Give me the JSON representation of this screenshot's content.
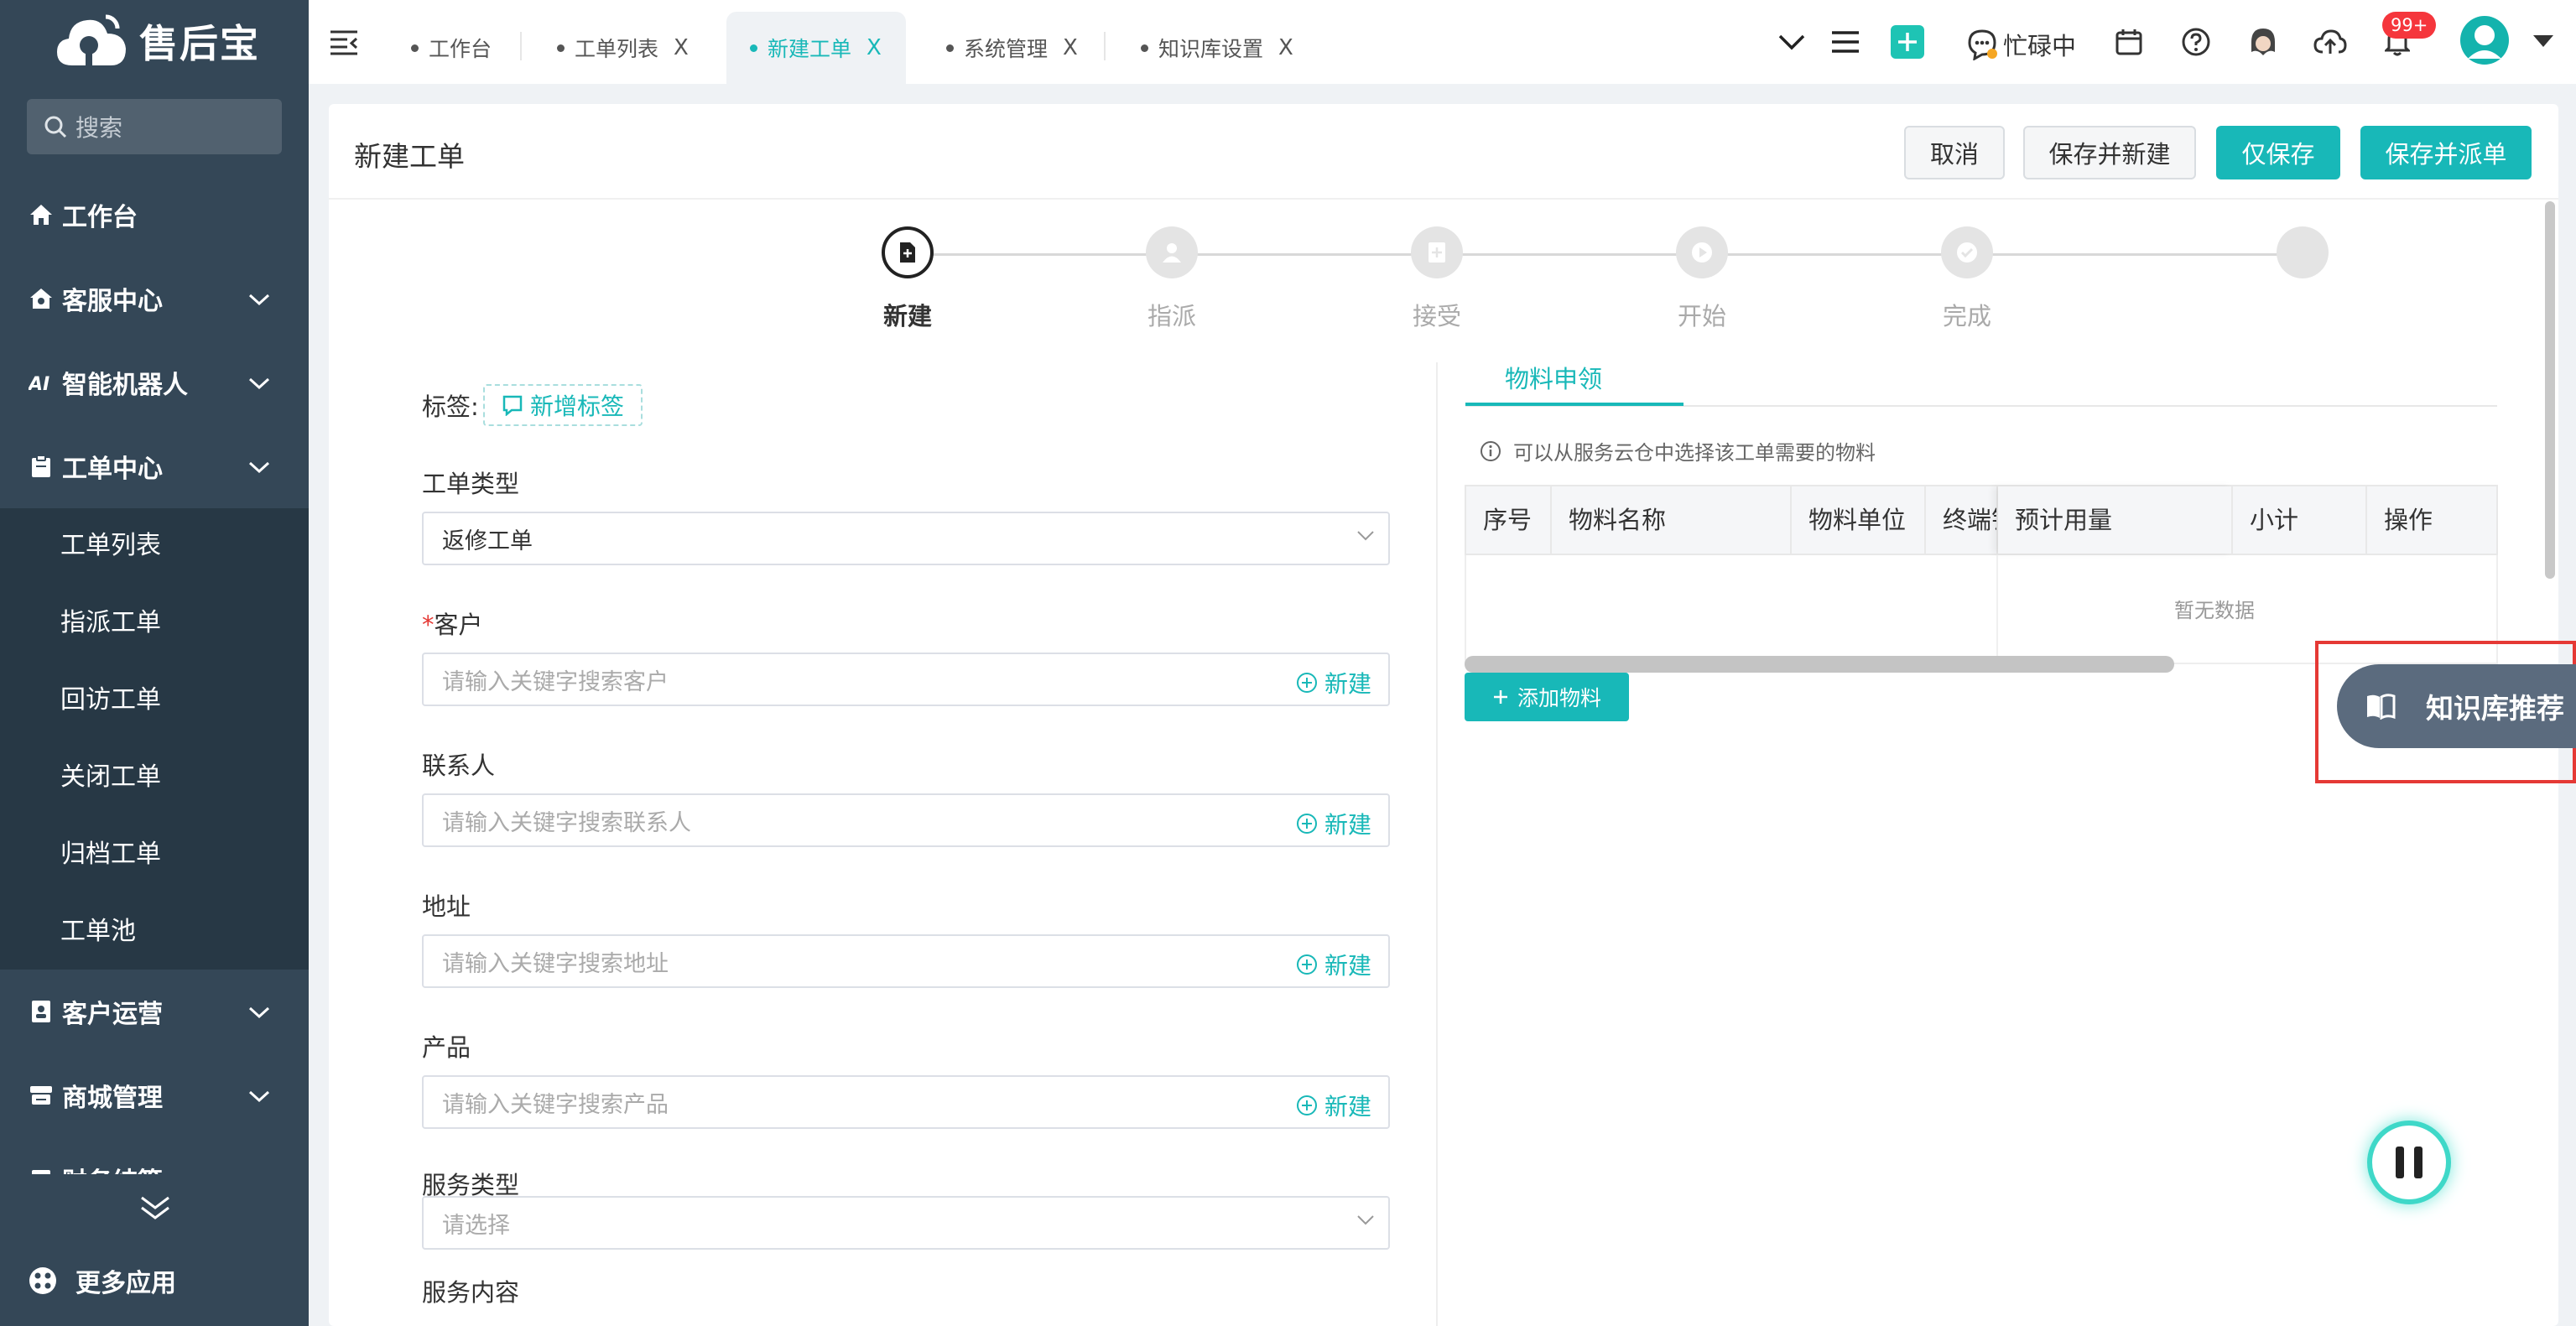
{
  "brand": {
    "name": "售后宝"
  },
  "sidebar": {
    "search_placeholder": "搜索",
    "nav": {
      "workbench": "工作台",
      "customer_service": "客服中心",
      "ai_robot": "智能机器人",
      "ticket_center": "工单中心",
      "customer_ops": "客户运营",
      "mall": "商城管理",
      "finance_partial": "财务结算"
    },
    "submenu": [
      "工单列表",
      "指派工单",
      "回访工单",
      "关闭工单",
      "归档工单",
      "工单池"
    ],
    "more_apps": "更多应用"
  },
  "tabs": [
    {
      "label": "工作台"
    },
    {
      "label": "工单列表",
      "close": "X"
    },
    {
      "label": "新建工单",
      "close": "X"
    },
    {
      "label": "系统管理",
      "close": "X"
    },
    {
      "label": "知识库设置",
      "close": "X"
    }
  ],
  "topbar": {
    "status": "忙碌中",
    "notification_badge": "99+"
  },
  "page": {
    "title": "新建工单",
    "actions": {
      "cancel": "取消",
      "save_new": "保存并新建",
      "save_only": "仅保存",
      "save_dispatch": "保存并派单"
    }
  },
  "steps": [
    "新建",
    "指派",
    "接受",
    "开始",
    "完成"
  ],
  "form": {
    "tags_label": "标签:",
    "add_tag": "新增标签",
    "new_label": "新建",
    "ticket_type": {
      "label": "工单类型",
      "value": "返修工单"
    },
    "customer": {
      "required_mark": "*",
      "label": "客户",
      "placeholder": "请输入关键字搜索客户"
    },
    "contact": {
      "label": "联系人",
      "placeholder": "请输入关键字搜索联系人"
    },
    "address": {
      "label": "地址",
      "placeholder": "请输入关键字搜索地址"
    },
    "product": {
      "label": "产品",
      "placeholder": "请输入关键字搜索产品"
    },
    "service_type": {
      "label": "服务类型",
      "placeholder": "请选择"
    },
    "service_content": {
      "label": "服务内容"
    }
  },
  "materials": {
    "tab": "物料申领",
    "hint": "可以从服务云仓中选择该工单需要的物料",
    "columns": [
      "序号",
      "物料名称",
      "物料单位",
      "终端销",
      "预计用量",
      "小计",
      "操作"
    ],
    "empty": "暂无数据",
    "add_button": "添加物料"
  },
  "knowledge_button": "知识库推荐"
}
